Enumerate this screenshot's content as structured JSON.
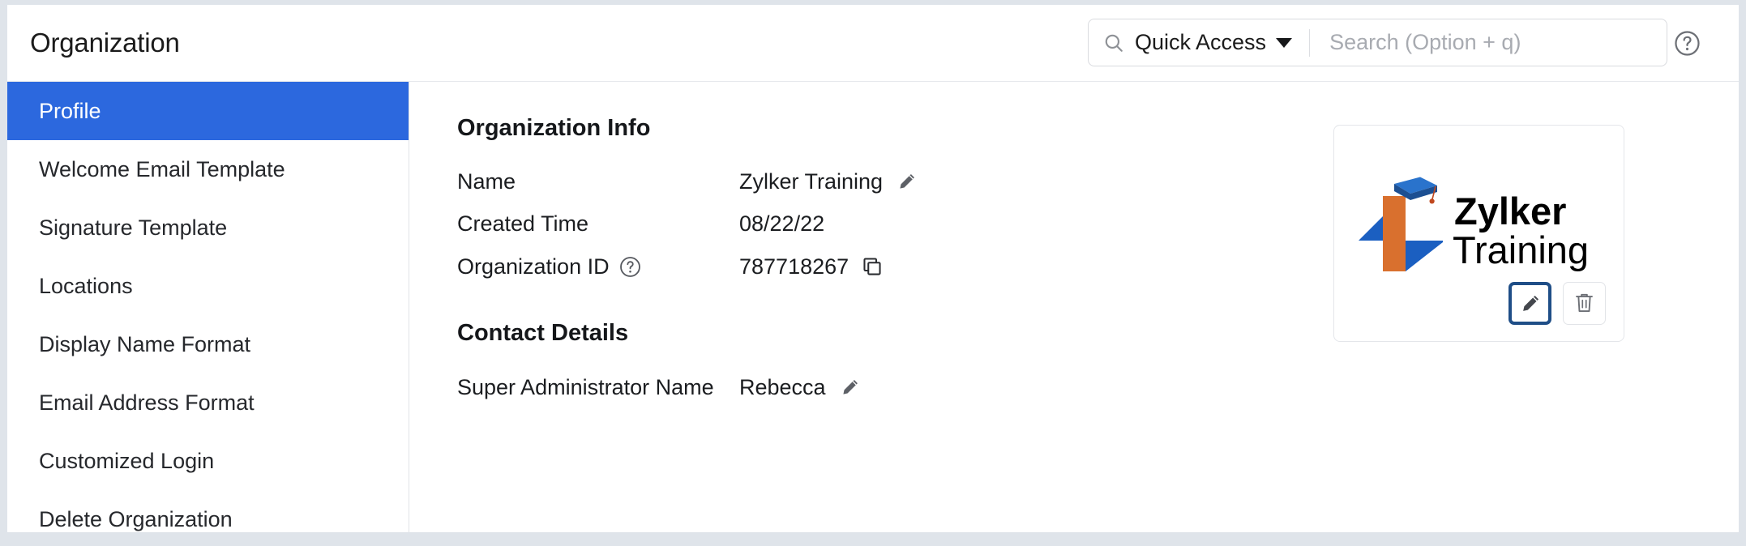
{
  "header": {
    "title": "Organization",
    "search": {
      "quick_access_label": "Quick Access",
      "placeholder": "Search (Option + q)",
      "value": ""
    },
    "help_icon": "question-circle-icon"
  },
  "sidebar": {
    "items": [
      {
        "label": "Profile",
        "active": true
      },
      {
        "label": "Welcome Email Template",
        "active": false
      },
      {
        "label": "Signature Template",
        "active": false
      },
      {
        "label": "Locations",
        "active": false
      },
      {
        "label": "Display Name Format",
        "active": false
      },
      {
        "label": "Email Address Format",
        "active": false
      },
      {
        "label": "Customized Login",
        "active": false
      },
      {
        "label": "Delete Organization",
        "active": false
      }
    ]
  },
  "main": {
    "org_info": {
      "title": "Organization Info",
      "rows": [
        {
          "label": "Name",
          "value": "Zylker Training",
          "action": "edit-pencil-icon"
        },
        {
          "label": "Created Time",
          "value": "08/22/22",
          "action": "none"
        },
        {
          "label": "Organization ID",
          "value": "787718267",
          "action": "copy-icon",
          "label_hint": "question-circle-icon"
        }
      ]
    },
    "contact_details": {
      "title": "Contact Details",
      "rows": [
        {
          "label": "Super Administrator Name",
          "value": "Rebecca",
          "action": "edit-pencil-icon"
        }
      ]
    },
    "logo_card": {
      "logo_name_bold": "Zylker",
      "logo_name_light": "Training",
      "edit_icon": "edit-pencil-icon",
      "delete_icon": "trash-icon"
    }
  },
  "colors": {
    "accent_blue": "#2c68de",
    "logo_blue": "#1b5fc1",
    "logo_orange": "#d9702e",
    "focus_border": "#1f4e87",
    "frame_gray": "#dfe4ea",
    "text_dark": "#1b1d20",
    "placeholder_gray": "#a8abb1"
  }
}
